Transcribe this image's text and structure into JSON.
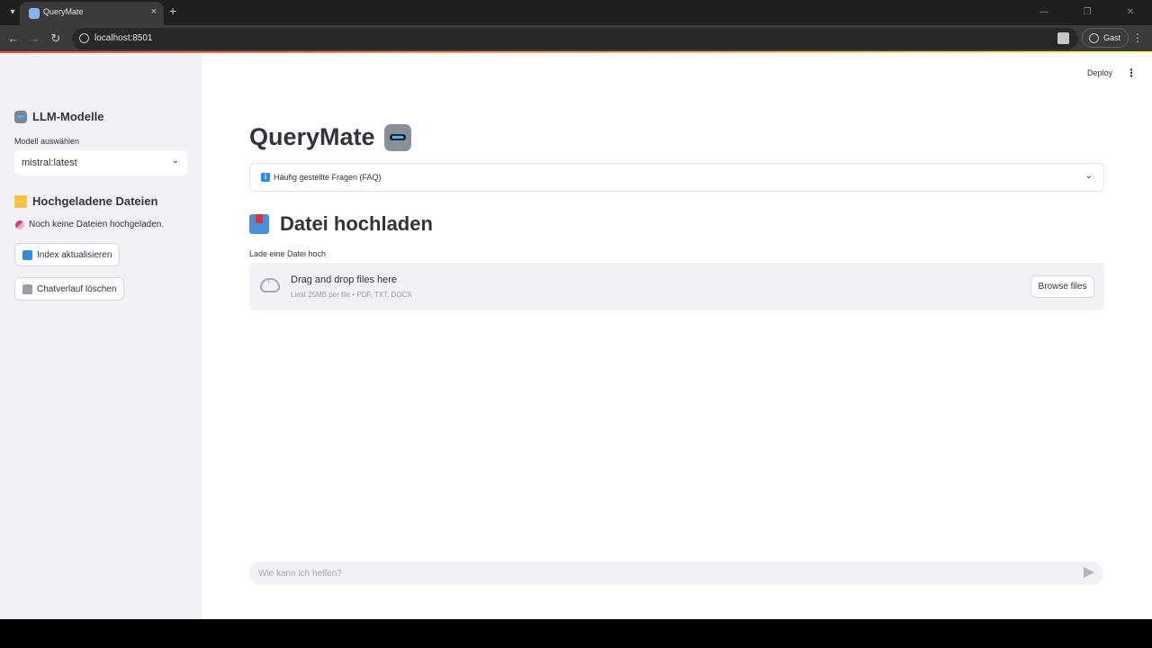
{
  "browser": {
    "tab_title": "QueryMate",
    "tab_close": "×",
    "new_tab": "+",
    "url": "localhost:8501",
    "profile_label": "Gast",
    "back": "←",
    "forward": "→",
    "reload": "↻"
  },
  "sidebar": {
    "models_heading": "LLM-Modelle",
    "model_select_label": "Modell auswählen",
    "model_selected": "mistral:latest",
    "files_heading": "Hochgeladene Dateien",
    "no_files_text": "Noch keine Dateien hochgeladen.",
    "refresh_index_label": "Index aktualisieren",
    "clear_chat_label": "Chatverlauf löschen"
  },
  "header": {
    "deploy_label": "Deploy",
    "menu_icon": "⋮"
  },
  "main": {
    "title": "QueryMate",
    "faq_label": "Häufig gestellte Fragen (FAQ)",
    "faq_icon_text": "i",
    "upload_heading": "Datei hochladen",
    "upload_label": "Lade eine Datei hoch",
    "dropzone_title": "Drag and drop files here",
    "dropzone_sub": "Limit 25MB per file • PDF, TXT, DOCX",
    "browse_label": "Browse files"
  },
  "chat": {
    "placeholder": "Wie kann ich helfen?"
  },
  "icons": {
    "robot": "robot-emoji",
    "folder": "folder-emoji",
    "pill": "pill-emoji",
    "refresh": "arrows-counterclockwise-emoji",
    "trash": "wastebasket-emoji",
    "inbox": "inbox-tray-emoji",
    "upload": "cloud-upload-icon",
    "send": "send-icon"
  },
  "colors": {
    "accent_gradient_start": "#ff4b4b",
    "accent_gradient_end": "#fffd80",
    "sidebar_bg": "#f0f2f6",
    "text": "#31333f",
    "info_blue": "#2f8ce6"
  }
}
